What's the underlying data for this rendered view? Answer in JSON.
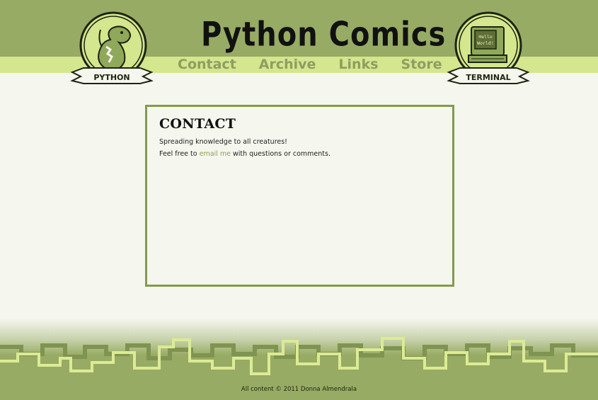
{
  "site": {
    "title": "Python Comics",
    "colors": {
      "header": "#98ab64",
      "nav_band": "#d4e68e",
      "nav_text": "#8f9d60",
      "page_bg": "#f5f6ee",
      "border": "#849a4d"
    }
  },
  "nav": {
    "items": [
      {
        "label": "Contact"
      },
      {
        "label": "Archive"
      },
      {
        "label": "Links"
      },
      {
        "label": "Store"
      }
    ]
  },
  "badges": {
    "left": {
      "label": "PYTHON",
      "icon": "snake-mascot-icon"
    },
    "right": {
      "label": "TERMINAL",
      "screen_text": "Hello World!",
      "icon": "computer-terminal-icon"
    }
  },
  "content": {
    "heading": "CONTACT",
    "tagline": "Spreading knowledge to all creatures!",
    "contact_prefix": "Feel free to ",
    "email_link": "email me",
    "contact_suffix": " with questions or comments."
  },
  "footer": {
    "copyright": "All content © 2011 Donna Almendrala"
  }
}
